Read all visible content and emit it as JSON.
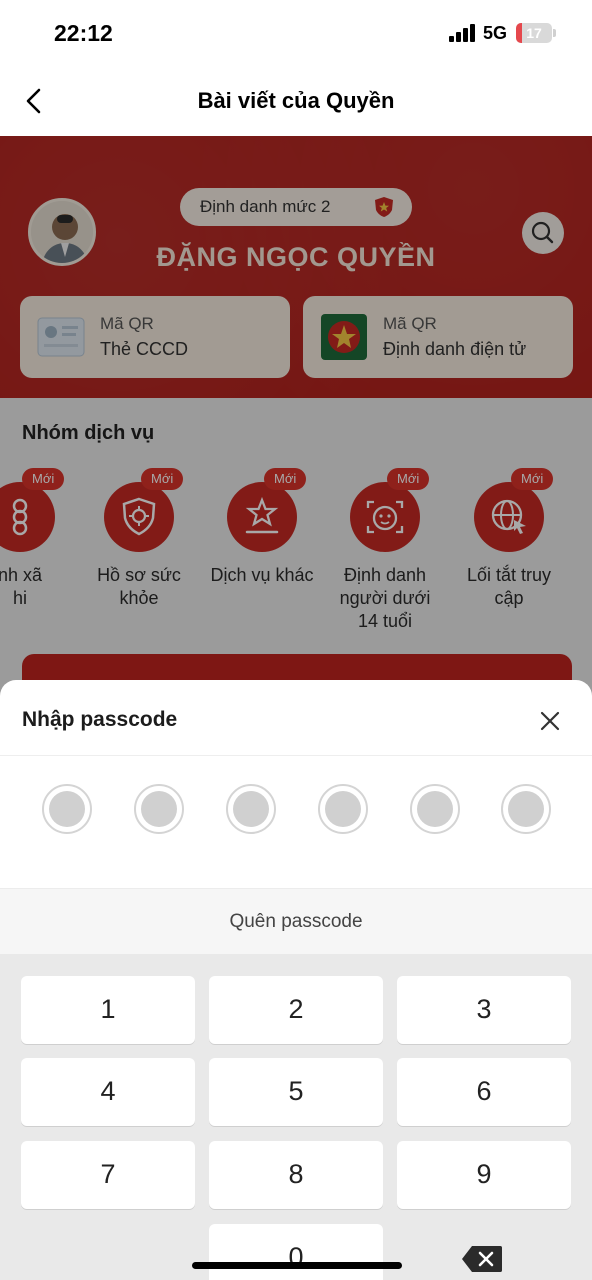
{
  "status_bar": {
    "time": "22:12",
    "network": "5G",
    "battery": "17",
    "battery_level": 0.17
  },
  "nav": {
    "title": "Bài viết của Quyền",
    "back_icon": "chevron-left-icon"
  },
  "profile": {
    "badge": "Định danh mức 2",
    "name": "ĐẶNG NGỌC QUYỀN",
    "qr_cards": [
      {
        "line1": "Mã QR",
        "line2": "Thẻ CCCD"
      },
      {
        "line1": "Mã QR",
        "line2": "Định danh điện tử"
      }
    ]
  },
  "services": {
    "title": "Nhóm dịch vụ",
    "new_label": "Mới",
    "items": [
      {
        "label": "nh xã\nhi",
        "icon": "flower-icon"
      },
      {
        "label": "Hồ sơ sức\nkhỏe",
        "icon": "shield-virus-icon"
      },
      {
        "label": "Dịch vụ khác",
        "icon": "star-podium-icon"
      },
      {
        "label": "Định danh\nngười dưới\n14 tuổi",
        "icon": "child-face-icon"
      },
      {
        "label": "Lối tắt truy\ncập",
        "icon": "globe-cursor-icon"
      }
    ]
  },
  "passcode_sheet": {
    "title": "Nhập passcode",
    "forgot": "Quên passcode",
    "keys": [
      "1",
      "2",
      "3",
      "4",
      "5",
      "6",
      "7",
      "8",
      "9",
      "0"
    ]
  },
  "colors": {
    "brand_red": "#b3211c",
    "badge_red": "#d9332a",
    "keypad_bg": "#e9e9e9"
  }
}
